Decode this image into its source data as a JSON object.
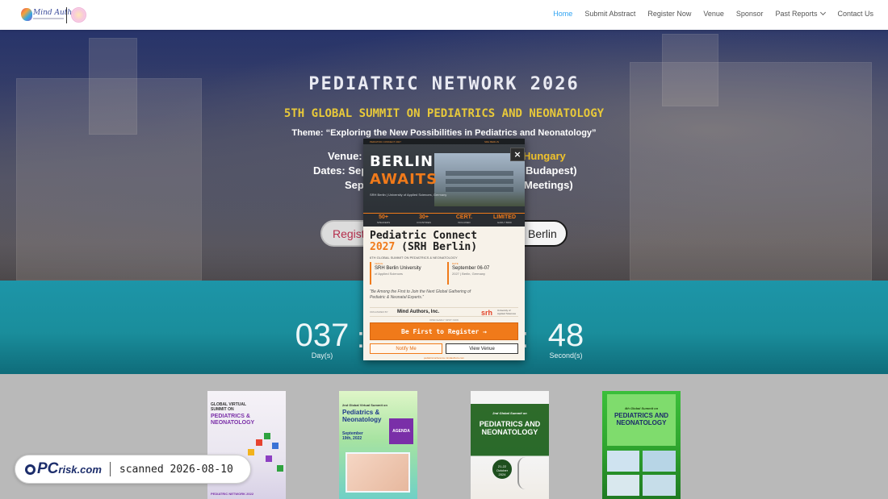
{
  "header": {
    "logo_text": "Mind Authors",
    "nav": [
      {
        "label": "Home",
        "active": true
      },
      {
        "label": "Submit Abstract"
      },
      {
        "label": "Register Now"
      },
      {
        "label": "Venue"
      },
      {
        "label": "Sponsor"
      },
      {
        "label": "Past Reports",
        "has_dropdown": true
      },
      {
        "label": "Contact Us"
      }
    ],
    "active_color": "#2ea3f2"
  },
  "hero": {
    "title": "PEDIATRIC NETWORK 2026",
    "subtitle": "5TH GLOBAL SUMMIT ON PEDIATRICS AND NEONATOLOGY",
    "theme": "Theme: “Exploring the New Possibilities in Pediatrics and Neonatology”",
    "venue_label": "Venue:",
    "venue_value_visible": "Hungary",
    "dates_label": "Dates: Sep",
    "dates_visible_end": "Budapest)",
    "dates_line2_start": "Sep",
    "dates_line2_end": "Meetings)",
    "button_left_visible": "Regist",
    "button_right_visible": "Berlin",
    "accent_color": "#f1c32b"
  },
  "countdown": {
    "days_value": "037",
    "days_label": "Day(s)",
    "separator_1": ":",
    "separator_2": ":",
    "seconds_value": "48",
    "seconds_label": "Second(s)",
    "background_color": "#1d95a8"
  },
  "reports": {
    "cards": [
      {
        "title_line1": "GLOBAL VIRTUAL",
        "title_line2": "SUMMIT ON",
        "title_line3": "PEDIATRICS &",
        "title_line4": "NEONATOLOGY",
        "footer": "PEDIATRIC NETWORK 2022"
      },
      {
        "title_line1": "2nd Global Virtual Summit on",
        "title_line2": "Pediatrics &",
        "title_line3": "Neonatology",
        "badge": "AGENDA",
        "date": "September",
        "date2": "19th, 2022"
      },
      {
        "title_line1": "2nd Global Summit on",
        "title_line2": "PEDIATRICS AND",
        "title_line3": "NEONATOLOGY",
        "date": "21-22",
        "date2": "October",
        "date3": "2024"
      },
      {
        "title_line1": "4th Global Summit on",
        "title_line2": "PEDIATRICS AND",
        "title_line3": "NEONATOLOGY"
      }
    ]
  },
  "watermark": {
    "brand_pc": "PC",
    "brand_risk": "risk.com",
    "scanned_text": "scanned 2026-08-10"
  },
  "popup": {
    "top_bar_left": "PEDIATRIC CONNECT 2027",
    "top_bar_right": "SRH BERLIN",
    "headline_1": "BERLIN",
    "headline_2": "AWAITS",
    "location": "SRH Berlin | University of Applied Sciences, Germany",
    "stats": [
      {
        "value": "50+",
        "label": "SPEAKERS"
      },
      {
        "value": "30+",
        "label": "COUNTRIES"
      },
      {
        "value": "CERT.",
        "label": "INCLUDED"
      },
      {
        "value": "LIMITED",
        "label": "EARLY BIRD"
      }
    ],
    "title_line1": "Pediatric Connect",
    "title_year": "2027",
    "title_rest": " (SRH Berlin)",
    "subline": "6TH GLOBAL SUMMIT ON PEDIATRICS & NEONATOLOGY",
    "venue_key": "VENUE",
    "venue_value": "SRH Berlin University",
    "venue_sub": "of Applied Sciences",
    "date_key": "DATE",
    "date_value": "September 06-07",
    "date_sub": "2027 | Berlin, Germany",
    "quote": "“Be Among the First to Join the Next Global Gathering of Pediatric & Neonatal Experts.”",
    "sponsor_key": "ORGANIZED BY",
    "sponsor_name": "Mind Authors, Inc.",
    "srh": "srh",
    "srh_sub": "University of Applied Sciences",
    "early_text": "OPEN EARLY SPOT NOW",
    "cta": "Be First to Register →",
    "notify": "Notify Me",
    "view_venue": "View Venue",
    "footer": "pediatricconference.mindauthors.com",
    "close": "×",
    "accent_color": "#f07a1a"
  }
}
